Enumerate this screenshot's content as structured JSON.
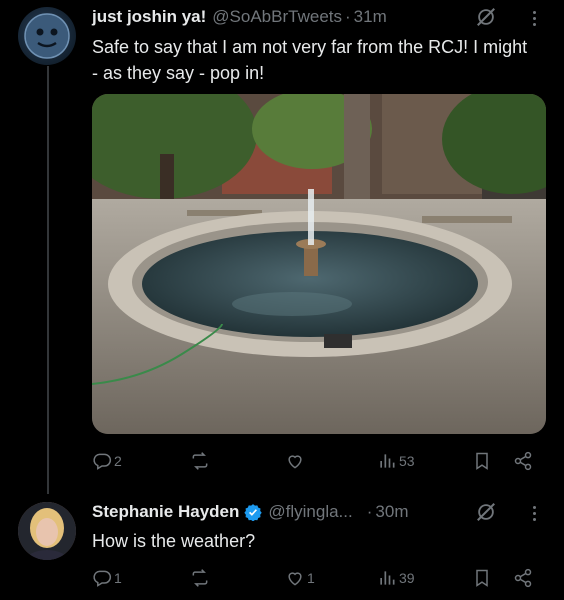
{
  "tweet1": {
    "display_name": "just joshin ya!",
    "handle": "@SoAbBrTweets",
    "separator": "·",
    "time": "31m",
    "text": "Safe to say that I am not very far from the RCJ! I might - as they say - pop in!",
    "image_alt": "A circular stone fountain in a paved square surrounded by trees and brick buildings",
    "stats": {
      "replies": "2",
      "reposts": "",
      "likes": "",
      "views": "53"
    }
  },
  "tweet2": {
    "display_name": "Stephanie Hayden",
    "handle": "@flyingla...",
    "separator": "·",
    "time": "30m",
    "text": "How is the weather?",
    "stats": {
      "replies": "1",
      "reposts": "",
      "likes": "1",
      "views": "39"
    }
  },
  "icons": [
    "reply-icon",
    "repost-icon",
    "like-icon",
    "views-icon",
    "bookmark-icon",
    "share-icon",
    "grok-icon",
    "more-icon",
    "verified-icon"
  ],
  "colors": {
    "background": "#000000",
    "text": "#e7e9ea",
    "muted": "#71767b",
    "verified": "#1d9bf0"
  }
}
